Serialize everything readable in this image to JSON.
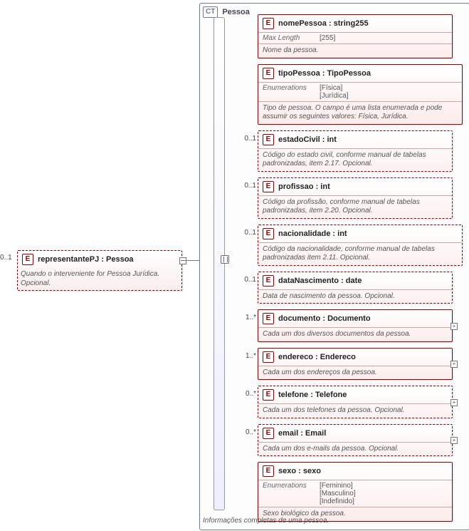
{
  "root": {
    "occurrence": "0..1",
    "tag": "E",
    "name": "representantePJ",
    "type": "Pessoa",
    "desc": "Quando o interveniente for Pessoa Jurídica. Opcional."
  },
  "ct": {
    "tag": "CT",
    "name": "Pessoa",
    "footer": "Informações completas de uma pessoa."
  },
  "children": [
    {
      "tag": "E",
      "name": "nomePessoa",
      "type": "string255",
      "facets": [
        {
          "label": "Max Length",
          "value": "[255]"
        }
      ],
      "desc": "Nome da pessoa.",
      "occ": "",
      "dashed": false,
      "expand": false
    },
    {
      "tag": "E",
      "name": "tipoPessoa",
      "type": "TipoPessoa",
      "facets": [
        {
          "label": "Enumerations",
          "value": "[Física]\n[Jurídica]"
        }
      ],
      "desc": "Tipo de pessoa. O campo é uma lista enumerada e pode assumir os seguintes valores: Física, Jurídica.",
      "occ": "",
      "dashed": false,
      "expand": false,
      "wide": true
    },
    {
      "tag": "E",
      "name": "estadoCivil",
      "type": "int",
      "desc": "Código do estado civil, conforme manual de tabelas padronizadas, item 2.17. Opcional.",
      "occ": "0..1",
      "dashed": true,
      "expand": false
    },
    {
      "tag": "E",
      "name": "profissao",
      "type": "int",
      "desc": "Código da profissão, conforme manual de tabelas padronizadas, item 2.20. Opcional.",
      "occ": "0..1",
      "dashed": true,
      "expand": false
    },
    {
      "tag": "E",
      "name": "nacionalidade",
      "type": "int",
      "desc": "Código da nacionalidade, conforme manual de tabelas padronizadas item 2.11. Opcional.",
      "occ": "0..1",
      "dashed": true,
      "expand": false,
      "wide": true
    },
    {
      "tag": "E",
      "name": "dataNascimento",
      "type": "date",
      "desc": "Data de nascimento da pessoa. Opcional.",
      "occ": "0..1",
      "dashed": true,
      "expand": false
    },
    {
      "tag": "E",
      "name": "documento",
      "type": "Documento",
      "desc": "Cada um dos diversos documentos da pessoa.",
      "occ": "1..*",
      "dashed": false,
      "expand": true
    },
    {
      "tag": "E",
      "name": "endereco",
      "type": "Endereco",
      "desc": "Cada um dos endereços da pessoa.",
      "occ": "1..*",
      "dashed": false,
      "expand": true
    },
    {
      "tag": "E",
      "name": "telefone",
      "type": "Telefone",
      "desc": "Cada um dos telefones da pessoa. Opcional.",
      "occ": "0..*",
      "dashed": true,
      "expand": true
    },
    {
      "tag": "E",
      "name": "email",
      "type": "Email",
      "desc": "Cada um dos e-mails da pessoa. Opcional.",
      "occ": "0..*",
      "dashed": true,
      "expand": true
    },
    {
      "tag": "E",
      "name": "sexo",
      "type": "sexo",
      "facets": [
        {
          "label": "Enumerations",
          "value": "[Feminino]\n[Masculino]\n[Indefinido]"
        }
      ],
      "desc": "Sexo biológico da pessoa.",
      "occ": "",
      "dashed": false,
      "expand": false
    }
  ]
}
